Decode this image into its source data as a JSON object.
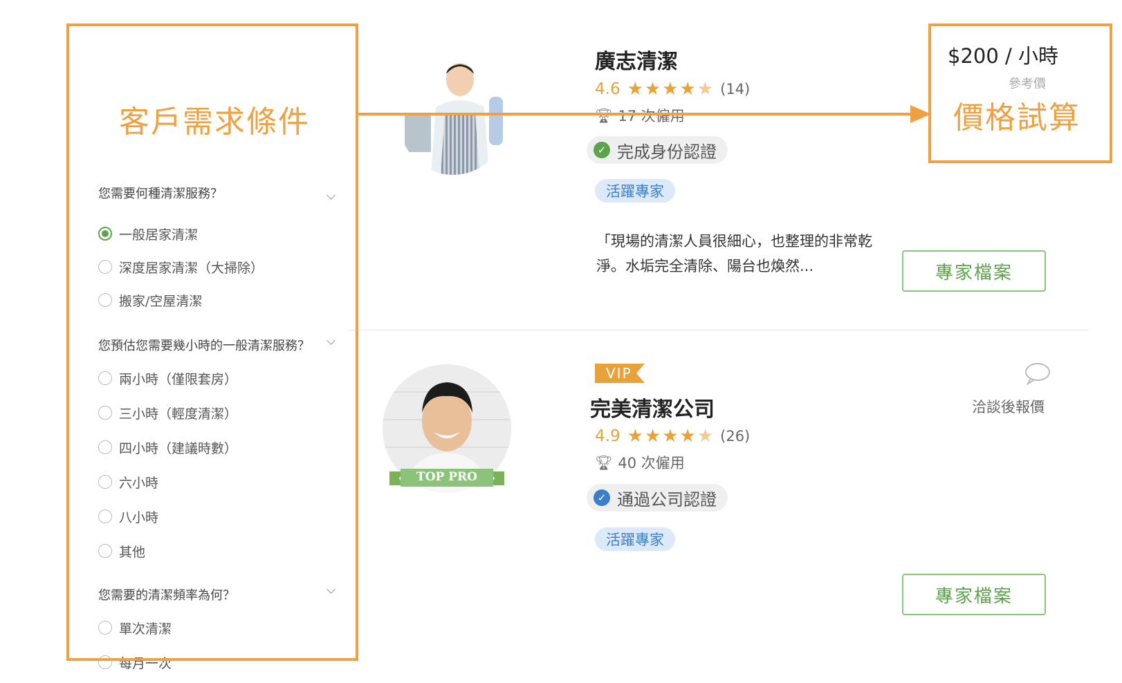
{
  "annotations": {
    "left_label": "客戶需求條件",
    "right_label": "價格試算"
  },
  "filters": {
    "groups": [
      {
        "title": "您需要何種清潔服務？",
        "options": [
          {
            "label": "一般居家清潔",
            "selected": true
          },
          {
            "label": "深度居家清潔（大掃除）",
            "selected": false
          },
          {
            "label": "搬家/空屋清潔",
            "selected": false
          }
        ]
      },
      {
        "title": "您預估您需要幾小時的一般清潔服務？",
        "options": [
          {
            "label": "兩小時（僅限套房）",
            "selected": false
          },
          {
            "label": "三小時（輕度清潔）",
            "selected": false
          },
          {
            "label": "四小時（建議時數）",
            "selected": false
          },
          {
            "label": "六小時",
            "selected": false
          },
          {
            "label": "八小時",
            "selected": false
          },
          {
            "label": "其他",
            "selected": false
          }
        ]
      },
      {
        "title": "您需要的清潔頻率為何？",
        "options": [
          {
            "label": "單次清潔",
            "selected": false
          },
          {
            "label": "每月一次",
            "selected": false
          }
        ]
      }
    ]
  },
  "cards": [
    {
      "name": "廣志清潔",
      "rating": "4.6",
      "stars": 4.5,
      "reviews": "(14)",
      "hires": "17 次僱用",
      "badge": "完成身份認證",
      "badge_color": "#5da34c",
      "tag": "活躍專家",
      "price": "$200 / 小時",
      "price_note": "參考價",
      "review": "「現場的清潔人員很細心，也整理的非常乾淨。水垢完全清除、陽台也煥然...",
      "button": "專家檔案"
    },
    {
      "vip": "VIP",
      "name": "完美清潔公司",
      "rating": "4.9",
      "stars": 4.5,
      "reviews": "(26)",
      "hires": "40 次僱用",
      "badge": "通過公司認證",
      "badge_color": "#3b7fc9",
      "tag": "活躍專家",
      "price_note": "洽談後報價",
      "top_pro": "TOP PRO",
      "button": "專家檔案"
    }
  ],
  "colors": {
    "annotation": "#f0a040",
    "accent_green": "#5da34c",
    "star": "#e8a23a",
    "tag_blue": "#3b7fc9"
  }
}
